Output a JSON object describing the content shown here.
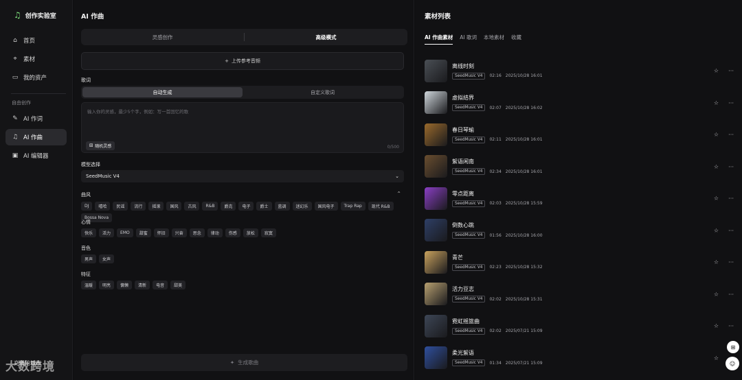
{
  "sidebar": {
    "brand": "创作实验室",
    "items": [
      {
        "label": "首页",
        "icon": "home-icon"
      },
      {
        "label": "素材",
        "icon": "location-icon"
      },
      {
        "label": "我的资产",
        "icon": "folder-icon"
      }
    ],
    "group_label": "自由创作",
    "group_items": [
      {
        "label": "AI 作词",
        "icon": "wand-icon"
      },
      {
        "label": "AI 作曲",
        "icon": "music-note-icon",
        "active": true
      },
      {
        "label": "AI 编辑器",
        "icon": "editor-icon"
      }
    ],
    "bottom_label": "充值的城市"
  },
  "compose": {
    "title": "AI 作曲",
    "mode_tabs": [
      "灵感创作",
      "高级模式"
    ],
    "active_mode": "高级模式",
    "upload_label": "上传参考音频",
    "lyrics_label": "歌词",
    "lyrics_tabs": [
      "自动生成",
      "自定义歌词"
    ],
    "lyrics_placeholder": "输入你的灵感，最少5个字，例如：写一首回忆的歌",
    "inspire_label": "随机灵感",
    "char_count": "0/500",
    "model_label": "模型选择",
    "model_value": "SeedMusic V4",
    "style_label": "曲风",
    "style_tags": [
      "DJ",
      "嘻哈",
      "民谣",
      "流行",
      "摇滚",
      "国风",
      "古风",
      "R&B",
      "爵克",
      "电子",
      "爵士",
      "蓝调",
      "迷幻乐",
      "国风电子",
      "Trap Rap",
      "现代 R&B",
      "Bossa Nova"
    ],
    "mood_label": "心情",
    "mood_tags": [
      "快乐",
      "活力",
      "EMO",
      "甜蜜",
      "怀旧",
      "兴奋",
      "思念",
      "律动",
      "伤感",
      "放松",
      "寂寞"
    ],
    "voice_label": "音色",
    "voice_tags": [
      "男声",
      "女声"
    ],
    "feature_label": "特征",
    "feature_tags": [
      "温暖",
      "明亮",
      "慵懒",
      "清新",
      "电音",
      "甜美"
    ],
    "generate_label": "生成歌曲"
  },
  "library": {
    "title": "素材列表",
    "tabs": [
      "AI 作曲素材",
      "AI 歌词",
      "本地素材",
      "收藏"
    ],
    "active_tab": "AI 作曲素材",
    "tracks": [
      {
        "title": "离线时刻",
        "model": "SeedMusic V4",
        "duration": "02:16",
        "date": "2025/10/28 16:01",
        "thumb": "#4a4f55"
      },
      {
        "title": "虚拟结界",
        "model": "SeedMusic V4",
        "duration": "02:07",
        "date": "2025/10/28 16:02",
        "thumb": "#cfd6db"
      },
      {
        "title": "春日琴瑜",
        "model": "SeedMusic V4",
        "duration": "02:11",
        "date": "2025/10/28 16:01",
        "thumb": "#9a6a2c"
      },
      {
        "title": "絮语闲南",
        "model": "SeedMusic V4",
        "duration": "02:34",
        "date": "2025/10/28 16:01",
        "thumb": "#6a4e2f"
      },
      {
        "title": "零点距离",
        "model": "SeedMusic V4",
        "duration": "02:03",
        "date": "2025/10/28 15:59",
        "thumb": "#8a3fc4"
      },
      {
        "title": "倒数心跳",
        "model": "SeedMusic V4",
        "duration": "01:56",
        "date": "2025/10/28 16:00",
        "thumb": "#2e3f66"
      },
      {
        "title": "青芒",
        "model": "SeedMusic V4",
        "duration": "02:23",
        "date": "2025/10/28 15:32",
        "thumb": "#c9a25e"
      },
      {
        "title": "活力豆志",
        "model": "SeedMusic V4",
        "duration": "02:02",
        "date": "2025/10/28 15:31",
        "thumb": "#b8a070"
      },
      {
        "title": "霓虹摇篮曲",
        "model": "SeedMusic V4",
        "duration": "02:02",
        "date": "2025/07/21 15:09",
        "thumb": "#3d4656"
      },
      {
        "title": "柔光絮语",
        "model": "SeedMusic V4",
        "duration": "01:34",
        "date": "2025/07/21 15:09",
        "thumb": "#2f4f9e"
      }
    ]
  },
  "watermark": "大数跨境"
}
